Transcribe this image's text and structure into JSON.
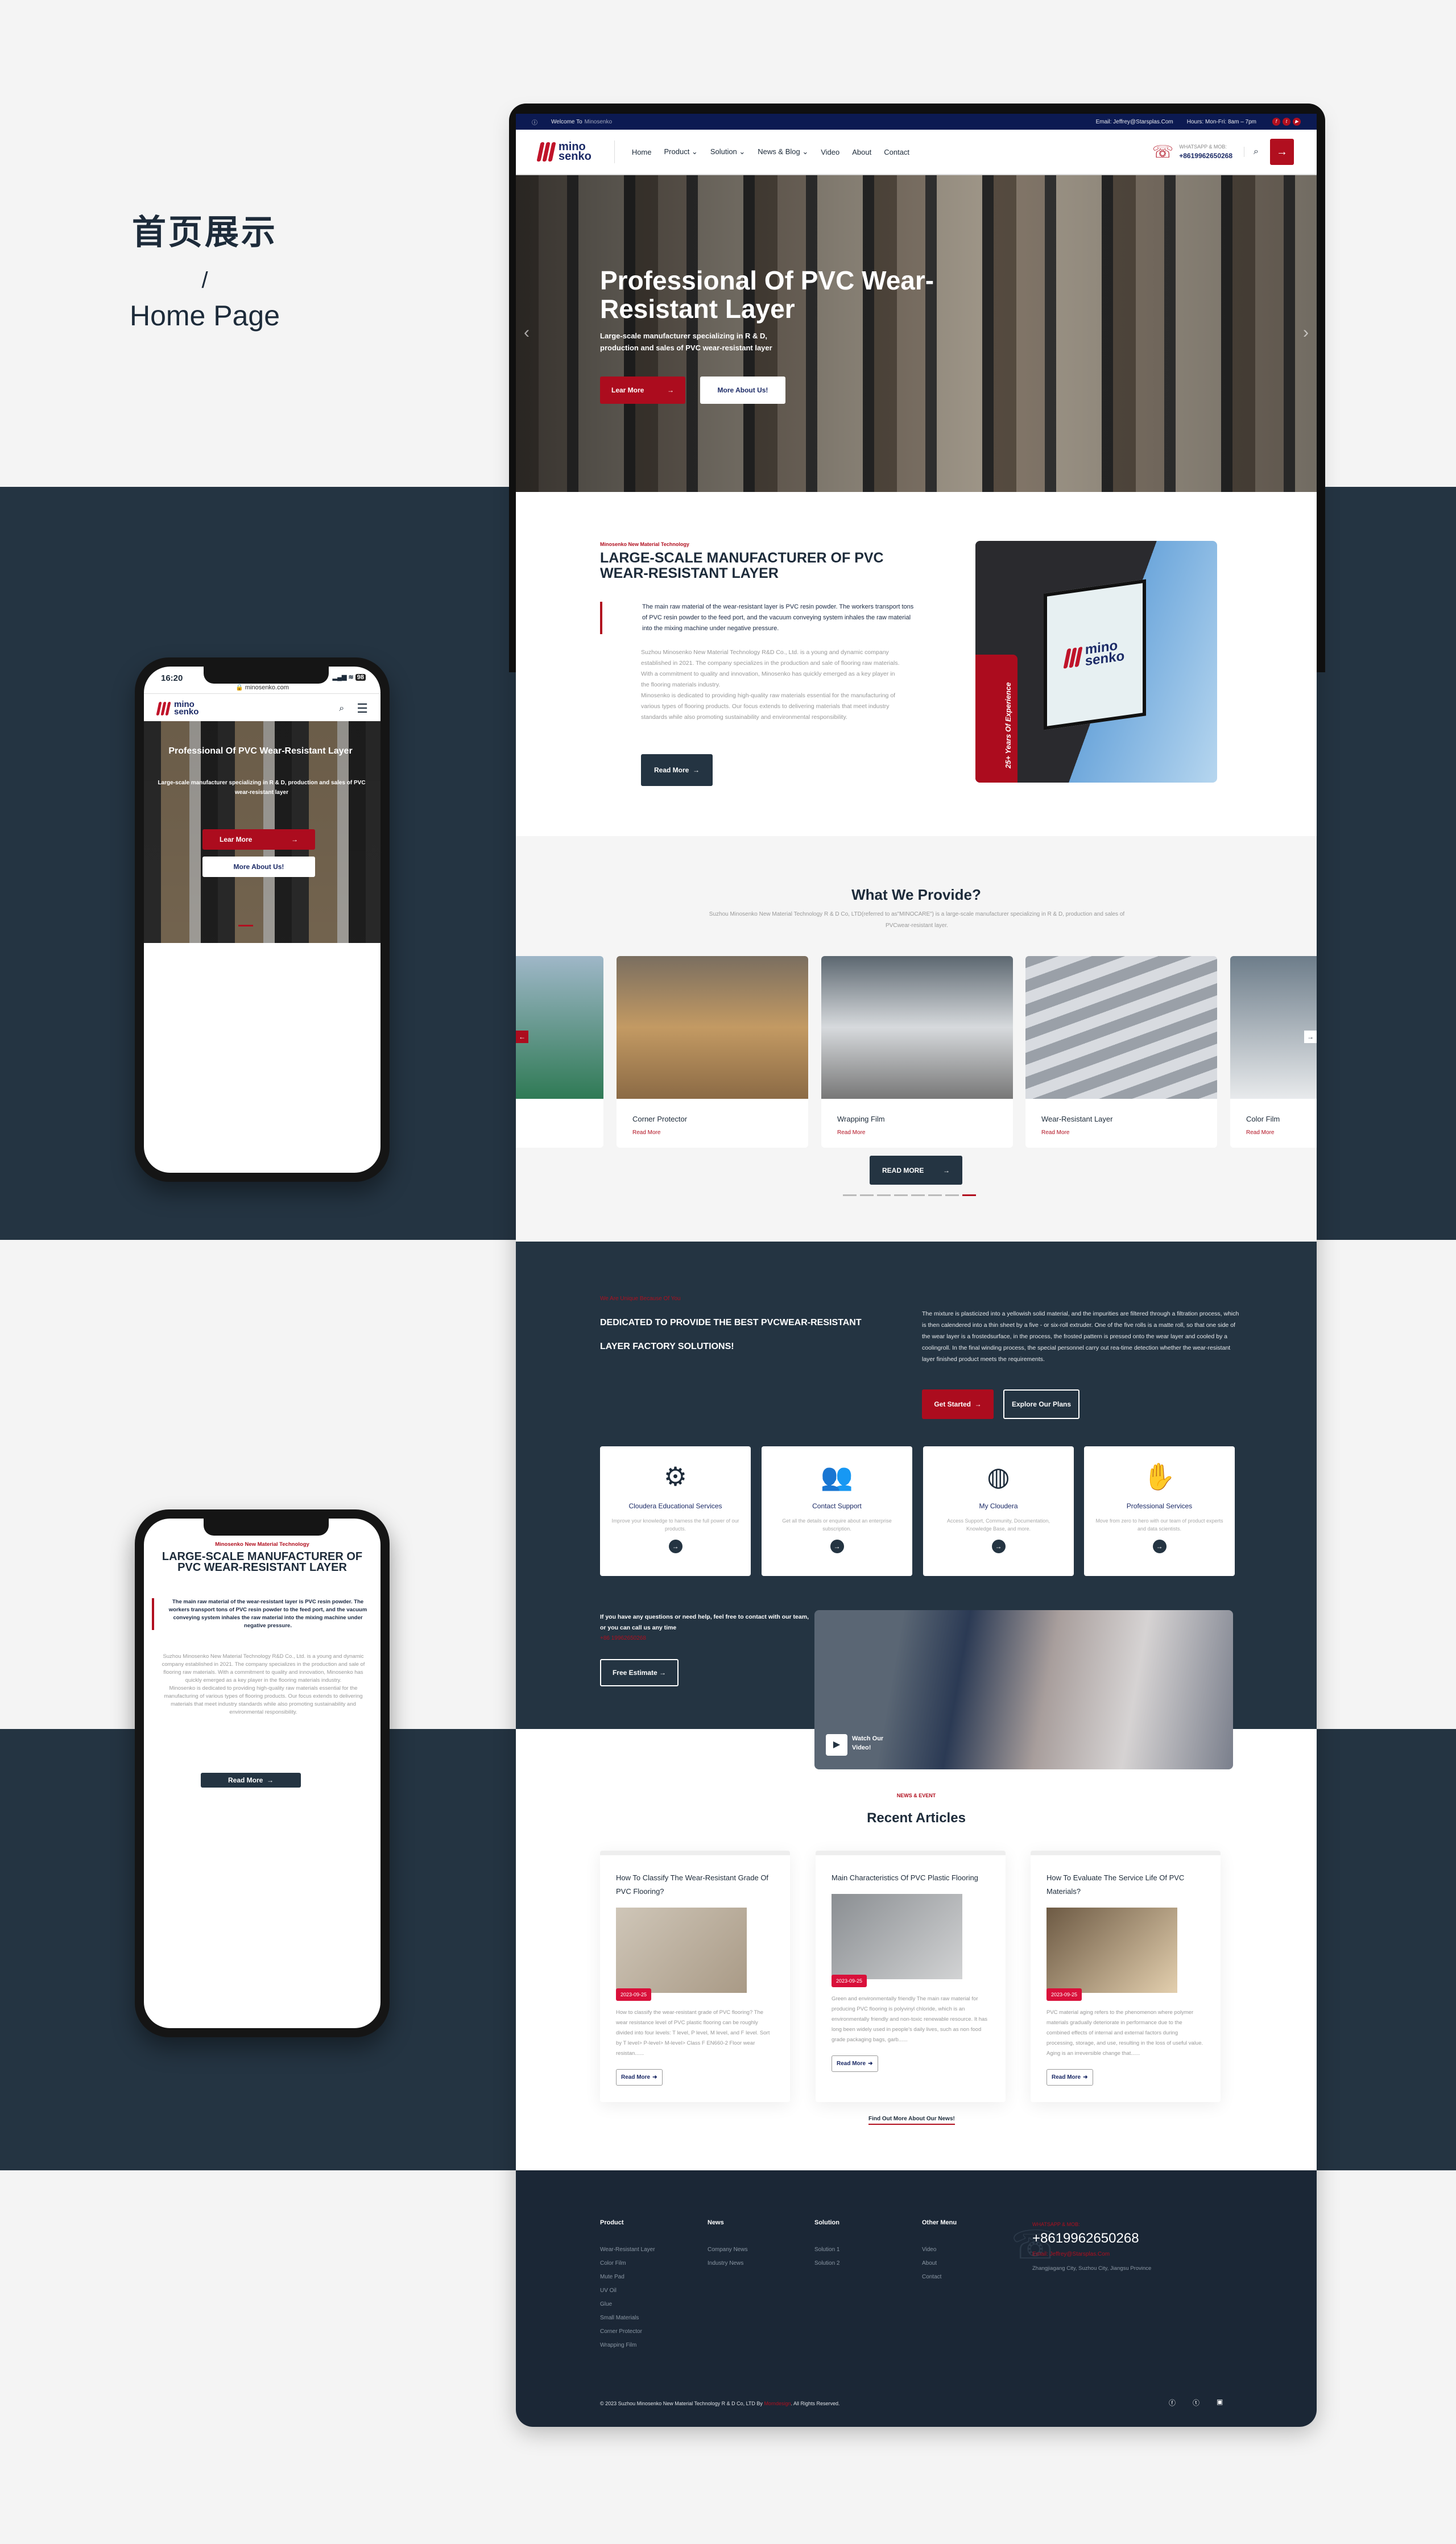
{
  "intro": {
    "title_cn": "首页展示",
    "slash": "/",
    "title_en": "Home Page"
  },
  "topbar": {
    "welcome": "Welcome To",
    "brand": "Minosenko",
    "email": "Email: Jeffrey@Starsplas.Com",
    "hours": "Hours: Mon-Fri: 8am – 7pm"
  },
  "nav": {
    "logo_top": "mino",
    "logo_bottom": "senko",
    "items": [
      "Home",
      "Product ⌄",
      "Solution ⌄",
      "News & Blog ⌄",
      "Video",
      "About",
      "Contact"
    ],
    "wa_label": "WHATSAPP & MOB:",
    "wa_number": "+8619962650268"
  },
  "hero": {
    "title": "Professional Of PVC Wear-Resistant Layer",
    "subtitle": "Large-scale manufacturer specializing in R & D, production and sales of PVC wear-resistant layer",
    "btn_primary": "Lear More",
    "btn_secondary": "More About Us!"
  },
  "about": {
    "label": "Minosenko New Material Technology",
    "title": "LARGE-SCALE MANUFACTURER OF PVC WEAR-RESISTANT LAYER",
    "quote": "The main raw material of the wear-resistant layer is PVC resin powder. The workers transport tons of PVC resin powder to the feed port, and the vacuum conveying system inhales the raw material into the mixing machine under negative pressure.",
    "body": "Suzhou Minosenko New Material Technology R&D Co., Ltd. is a young and dynamic company established in 2021. The company specializes in the production and sale of flooring raw materials. With a commitment to quality and innovation, Minosenko has quickly emerged as a key player in the flooring materials industry.",
    "body2": "Minosenko is dedicated to providing high-quality raw materials essential for the manufacturing of various types of flooring products. Our focus extends to delivering materials that meet industry standards while also promoting sustainability and environmental responsibility.",
    "button": "Read More",
    "experience": "25+  Years Of Experience"
  },
  "provide": {
    "title": "What We Provide?",
    "subtitle": "Suzhou Minosenko New Material Technology R & D Co, LTD(referred to as\"MINOCARE\") is a large-scale manufacturer specializing in R & D, production and sales of PVCwear-resistant layer.",
    "products": [
      {
        "name": "Corner Protector",
        "link": "Read More"
      },
      {
        "name": "Wrapping Film",
        "link": "Read More"
      },
      {
        "name": "Wear-Resistant Layer",
        "link": "Read More"
      },
      {
        "name": "Color Film",
        "link": "Read More"
      }
    ],
    "button": "READ MORE",
    "active_slide": 8,
    "slide_count": 8
  },
  "solutions": {
    "label": "We Are Unique Because Of You",
    "title": "DEDICATED TO PROVIDE THE BEST PVCWEAR-RESISTANT LAYER FACTORY SOLUTIONS!",
    "body": "The mixture is plasticized into a yellowish solid material, and the impurities are filtered through a filtration process, which is then calendered into a thin sheet by a five - or six-roll extruder. One of the five rolls is a matte roll, so that one side of the wear layer is a frostedsurface, in the process, the frosted pattern is pressed onto the wear layer and cooled by a coolingroll. In the final winding process, the special personnel carry out rea-time detection whether the wear-resistant layer finished product meets the requirements.",
    "btn_primary": "Get Started",
    "btn_secondary": "Explore Our Plans",
    "services": [
      {
        "icon": "gear-check-icon",
        "title": "Cloudera Educational Services",
        "text": "Improve your knowledge to harness the full power of our products."
      },
      {
        "icon": "team-icon",
        "title": "Contact Support",
        "text": "Get all the details or enquire about an enterprise subscription."
      },
      {
        "icon": "handshake-globe-icon",
        "title": "My Cloudera",
        "text": "Access Support, Community, Documentation, Knowledge Base, and more."
      },
      {
        "icon": "hands-together-icon",
        "title": "Professional Services",
        "text": "Move from zero to hero with our team of product experts and data scientists."
      }
    ],
    "contact_text": "If you have any questions or need help, feel free to contact with our team, or you can call us any time",
    "contact_phone": "+86 19962650268",
    "estimate": "Free Estimate",
    "video": "Watch Our Video!"
  },
  "news": {
    "label": "NEWS & EVENT",
    "title": "Recent Articles",
    "articles": [
      {
        "title": "How To Classify The Wear-Resistant Grade Of PVC Flooring?",
        "date": "2023-09-25",
        "excerpt": "How to classify the wear-resistant grade of PVC flooring? The wear resistance level of PVC plastic flooring can be roughly divided into four levels: T level, P level, M level, and F level. Sort by T level> P-level> M-level> Class F EN660-2 Floor wear resistan......",
        "link": "Read More"
      },
      {
        "title": "Main Characteristics Of PVC Plastic Flooring",
        "date": "2023-09-25",
        "excerpt": "Green and environmentally friendly The main raw material for producing PVC flooring is polyvinyl chloride, which is an environmentally friendly and non-toxic renewable resource. It has long been widely used in people's daily lives, such as non food grade packaging bags, garb......",
        "link": "Read More"
      },
      {
        "title": "How To Evaluate The Service Life Of PVC Materials?",
        "date": "2023-09-25",
        "excerpt": "PVC material aging refers to the phenomenon where polymer materials gradually deteriorate in performance due to the combined effects of internal and external factors during processing, storage, and use, resulting in the loss of useful value. Aging is an irreversible change that......",
        "link": "Read More"
      }
    ],
    "more": "Find Out More About Our News!"
  },
  "footer": {
    "columns": [
      {
        "title": "Product",
        "items": [
          "Wear-Resistant Layer",
          "Color Film",
          "Mute Pad",
          "UV Oil",
          "Glue",
          "Small Materials",
          "Corner Protector",
          "Wrapping Film"
        ]
      },
      {
        "title": "News",
        "items": [
          "Company News",
          "Industry News"
        ]
      },
      {
        "title": "Solution",
        "items": [
          "Solution 1",
          "Solution 2"
        ]
      },
      {
        "title": "Other Menu",
        "items": [
          "Video",
          "About",
          "Contact"
        ]
      }
    ],
    "wa_label": "WHATSAPP & MOB:",
    "phone": "+8619962650268",
    "email": "Email: Jeffrey@Starsplas.Com",
    "address": "Zhangjiagang City, Suzhou City, Jiangsu Province",
    "copyright_pre": "© 2023 Suzhou Minosenko New Material Technology R & D Co, LTD By ",
    "copyright_link": "Morndesign",
    "copyright_post": ". All Rights Reserved."
  },
  "phone1": {
    "time": "16:20",
    "battery": "98",
    "url": "minosenko.com",
    "title": "Professional Of PVC Wear-Resistant Layer",
    "subtitle": "Large-scale manufacturer specializing in R & D, production and sales of PVC wear-resistant layer",
    "btn_primary": "Lear More",
    "btn_secondary": "More About Us!"
  },
  "colors": {
    "brand_red": "#ac0c1e",
    "navy": "#0c1a52",
    "dark": "#243442",
    "footer": "#1b2736"
  }
}
